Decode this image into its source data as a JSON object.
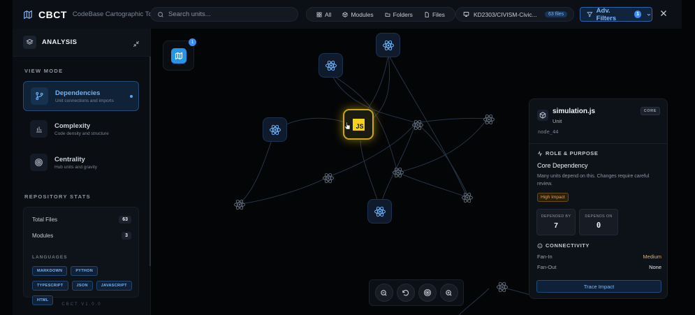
{
  "header": {
    "logo": "CBCT",
    "tagline": "CodeBase Cartographic Tool",
    "search_placeholder": "Search units...",
    "filters": [
      {
        "icon": "grid-icon",
        "label": "All"
      },
      {
        "icon": "cube-icon",
        "label": "Modules"
      },
      {
        "icon": "folder-icon",
        "label": "Folders"
      },
      {
        "icon": "file-icon",
        "label": "Files"
      }
    ],
    "repo": "KD2303/CIVISM-Civic...",
    "repo_badge": "63 files",
    "adv_filters_label": "Adv. Filters",
    "adv_filters_count": "1"
  },
  "sidebar": {
    "title": "ANALYSIS",
    "view_mode_label": "VIEW MODE",
    "modes": [
      {
        "label": "Dependencies",
        "sub": "Unit connections and imports",
        "active": true
      },
      {
        "label": "Complexity",
        "sub": "Code density and structure",
        "active": false
      },
      {
        "label": "Centrality",
        "sub": "Hub units and gravity",
        "active": false
      }
    ],
    "repo_stats_label": "REPOSITORY STATS",
    "stats": [
      {
        "label": "Total Files",
        "value": "63"
      },
      {
        "label": "Modules",
        "value": "3"
      }
    ],
    "languages_label": "LANGUAGES",
    "languages": [
      "MARKDOWN",
      "PYTHON",
      "TYPESCRIPT",
      "JSON",
      "JAVASCRIPT",
      "HTML"
    ],
    "version": "CBCT V1.0.0"
  },
  "canvas": {
    "map_badge": "1",
    "selected_node_label": "JS"
  },
  "panel": {
    "name": "simulation.js",
    "type": "Unit",
    "tag": "CORE",
    "id": "node_44",
    "role_title": "ROLE & PURPOSE",
    "role": "Core Dependency",
    "description": "Many units depend on this. Changes require careful review.",
    "impact": "High Impact",
    "depended_by_label": "DEPENDED BY",
    "depended_by": "7",
    "depends_on_label": "DEPENDS ON",
    "depends_on": "0",
    "connectivity_title": "CONNECTIVITY",
    "fan_in_label": "Fan-In",
    "fan_in": "Medium",
    "fan_out_label": "Fan-Out",
    "fan_out": "None",
    "trace_label": "Trace Impact"
  },
  "colors": {
    "accent": "#5aa4f5",
    "highlight": "#f4d21f",
    "impact": "#e6a43a"
  }
}
